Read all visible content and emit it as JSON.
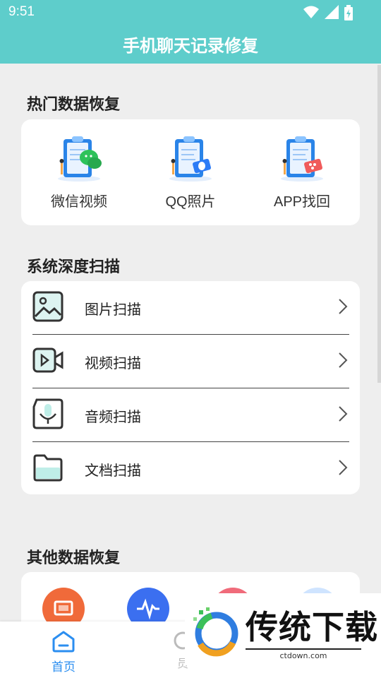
{
  "status_bar": {
    "time": "9:51",
    "icons": [
      "wifi-icon",
      "signal-icon",
      "battery-icon"
    ]
  },
  "app_bar": {
    "title": "手机聊天记录修复"
  },
  "hot_recovery": {
    "title": "热门数据恢复",
    "items": [
      {
        "label": "微信视频",
        "icon": "wechat-document-icon",
        "badge_color": "#2ec25a"
      },
      {
        "label": "QQ照片",
        "icon": "qq-document-icon",
        "badge_color": "#2d7cf6"
      },
      {
        "label": "APP找回",
        "icon": "app-document-icon",
        "badge_color": "#f05b5b"
      }
    ]
  },
  "deep_scan": {
    "title": "系统深度扫描",
    "items": [
      {
        "label": "图片扫描",
        "icon": "image-icon"
      },
      {
        "label": "视频扫描",
        "icon": "video-icon"
      },
      {
        "label": "音频扫描",
        "icon": "microphone-icon"
      },
      {
        "label": "文档扫描",
        "icon": "folder-icon"
      }
    ]
  },
  "other_recovery": {
    "title": "其他数据恢复",
    "items": [
      {
        "icon": "gallery-icon",
        "color": "#f06a3a"
      },
      {
        "icon": "audio-wave-icon",
        "color": "#3b6ff0"
      },
      {
        "icon": "pink-icon",
        "color": "#f06b7a"
      },
      {
        "icon": "blue-light-icon",
        "color": "#cfe4ff"
      }
    ]
  },
  "bottom_nav": {
    "home_label": "首页",
    "second_label": "员"
  },
  "watermark": {
    "text": "传统下载",
    "url": "ctdown.com"
  },
  "colors": {
    "primary": "#5ecdcb",
    "accent_blue": "#2b8ef0"
  }
}
